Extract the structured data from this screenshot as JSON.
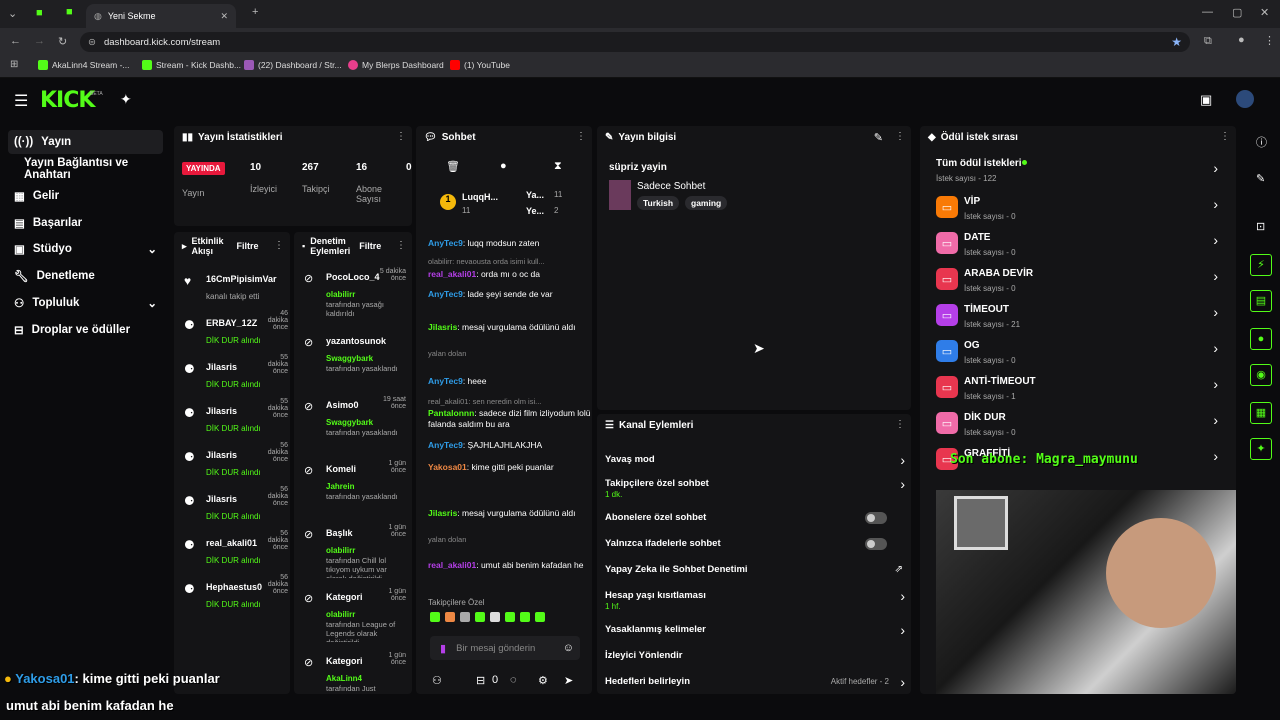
{
  "browser": {
    "tab_title": "Yeni Sekme",
    "url": "dashboard.kick.com/stream",
    "bookmarks": [
      "AkaLinn4 Stream -...",
      "Stream - Kick Dashb...",
      "(22) Dashboard / Str...",
      "My Blerps Dashboard",
      "(1) YouTube"
    ]
  },
  "app": {
    "logo": "KICK",
    "beta": "BETA"
  },
  "nav": {
    "items": [
      "Yayın",
      "Yayın Bağlantısı ve Anahtarı",
      "Gelir",
      "Başarılar",
      "Stüdyo",
      "Denetleme",
      "Topluluk",
      "Droplar ve ödüller"
    ]
  },
  "stats": {
    "title": "Yayın İstatistikleri",
    "live": "YAYINDA",
    "live_label": "Yayın",
    "viewers": "10",
    "viewers_label": "İzleyici",
    "followers": "267",
    "followers_label": "Takipçi",
    "subs": "16",
    "subs_label": "Abone Sayısı",
    "extra": "0"
  },
  "activity": {
    "title": "Etkinlik Akışı",
    "filter": "Filtre",
    "items": [
      {
        "name": "16CmPipisimVar",
        "text": "kanalı takip etti",
        "time": ""
      },
      {
        "name": "ERBAY_12Z",
        "text": "DİK DUR alındı",
        "time": "46 dakika önce"
      },
      {
        "name": "Jilasris",
        "text": "DİK DUR alındı",
        "time": "55 dakika önce"
      },
      {
        "name": "Jilasris",
        "text": "DİK DUR alındı",
        "time": "55 dakika önce"
      },
      {
        "name": "Jilasris",
        "text": "DİK DUR alındı",
        "time": "56 dakika önce"
      },
      {
        "name": "Jilasris",
        "text": "DİK DUR alındı",
        "time": "56 dakika önce"
      },
      {
        "name": "real_akali01",
        "text": "DİK DUR alındı",
        "time": "56 dakika önce"
      },
      {
        "name": "Hephaestus0",
        "text": "DİK DUR alındı",
        "time": "56 dakika önce"
      }
    ]
  },
  "moderation": {
    "title": "Denetim Eylemleri",
    "filter": "Filtre",
    "items": [
      {
        "name": "PocoLoco_4",
        "who": "olabilirr",
        "text": "tarafından yasağı kaldırıldı",
        "time": "5 dakika önce"
      },
      {
        "name": "yazantosunokuy",
        "who": "Swaggybark",
        "text": "tarafından yasaklandı",
        "time": ""
      },
      {
        "name": "Asimo0",
        "who": "Swaggybark",
        "text": "tarafından yasaklandı",
        "time": "19 saat önce"
      },
      {
        "name": "Komeli",
        "who": "Jahrein",
        "text": "tarafından yasaklandı",
        "time": "1 gün önce"
      },
      {
        "name": "Başlık",
        "who": "olabilirr",
        "text": "tarafından Chill lol tıkıyom uykum var olarak değiştirildi",
        "time": "1 gün önce"
      },
      {
        "name": "Kategori",
        "who": "olabilirr",
        "text": "tarafından League of Legends olarak değiştirildi",
        "time": "1 gün önce"
      },
      {
        "name": "Kategori",
        "who": "AkaLinn4",
        "text": "tarafından Just",
        "time": "1 gün önce"
      }
    ]
  },
  "chat": {
    "title": "Sohbet",
    "pinned_user": "LuqqH...",
    "pinned_count": "11",
    "top1": "Ya...",
    "top1_n": "11",
    "top2": "Ye...",
    "top2_n": "2",
    "messages": [
      {
        "user": "AnyTec9",
        "text": "luqq modsun zaten"
      },
      {
        "user": "",
        "text": "olabilirr: nevaousta orda isimi kull..."
      },
      {
        "user": "real_akali01",
        "text": "orda mı o oc da"
      },
      {
        "user": "AnyTec9",
        "text": "lade şeyi sende de var"
      },
      {
        "user": "Jilasris",
        "text": "mesaj vurgulama ödülünü aldı"
      },
      {
        "user": "",
        "text": "yalan dolan"
      },
      {
        "user": "AnyTec9",
        "text": "heee"
      },
      {
        "user": "",
        "text": "real_akali01: sen neredin olm isi..."
      },
      {
        "user": "Pantalonnn",
        "text": "sadece dizi film izliyodum lolü falanda saldım bu ara"
      },
      {
        "user": "AnyTec9",
        "text": "ŞAJHLAJHLAKJHA"
      },
      {
        "user": "Yakosa01",
        "text": "kime gitti peki puanlar"
      },
      {
        "user": "Jilasris",
        "text": "mesaj vurgulama ödülünü aldı"
      },
      {
        "user": "",
        "text": "yalan dolan"
      },
      {
        "user": "real_akali01",
        "text": "umut abi benim kafadan he"
      }
    ],
    "followers_only": "Takipçilere Özel",
    "placeholder": "Bir mesaj gönderin",
    "count": "0"
  },
  "info": {
    "title": "Yayın bilgisi",
    "stream_title": "süpriz yayin",
    "category": "Sadece Sohbet",
    "tags": [
      "Turkish",
      "gaming"
    ]
  },
  "channel": {
    "title": "Kanal Eylemleri",
    "items": [
      {
        "label": "Yavaş mod",
        "sub": ""
      },
      {
        "label": "Takipçilere özel sohbet",
        "sub": "1 dk."
      },
      {
        "label": "Abonelere özel sohbet",
        "sub": ""
      },
      {
        "label": "Yalnızca ifadelerle sohbet",
        "sub": ""
      },
      {
        "label": "Yapay Zeka ile Sohbet Denetimi",
        "sub": ""
      },
      {
        "label": "Hesap yaşı kısıtlaması",
        "sub": "1 hf."
      },
      {
        "label": "Yasaklanmış kelimeler",
        "sub": ""
      },
      {
        "label": "İzleyici Yönlendir",
        "sub": ""
      },
      {
        "label": "Hedefleri belirleyin",
        "sub": ""
      }
    ],
    "goals": "Aktif hedefler - 2"
  },
  "rewards": {
    "title": "Ödül istek sırası",
    "all": "Tüm ödül istekleri",
    "all_count": "İstek sayısı - 122",
    "items": [
      {
        "name": "VİP",
        "count": "İstek sayısı - 0",
        "color": "#f97a06"
      },
      {
        "name": "DATE",
        "count": "İstek sayısı - 0",
        "color": "#f06ba8"
      },
      {
        "name": "ARABA DEVİR",
        "count": "İstek sayısı - 0",
        "color": "#e8364f"
      },
      {
        "name": "TİMEOUT",
        "count": "İstek sayısı - 21",
        "color": "#b53fe8"
      },
      {
        "name": "OG",
        "count": "İstek sayısı - 0",
        "color": "#2f7de8"
      },
      {
        "name": "ANTİ-TİMEOUT",
        "count": "İstek sayısı - 1",
        "color": "#e8364f"
      },
      {
        "name": "DİK DUR",
        "count": "İstek sayısı - 0",
        "color": "#f06ba8"
      },
      {
        "name": "GRAFFİTİ",
        "count": "",
        "color": "#e8364f"
      }
    ]
  },
  "overlay": {
    "sub": "Son abone: Magra_maymunu",
    "chat1_user": "Yakosa01",
    "chat1_text": ": kime gitti peki puanlar",
    "chat2_text": "umut abi benim kafadan he"
  }
}
